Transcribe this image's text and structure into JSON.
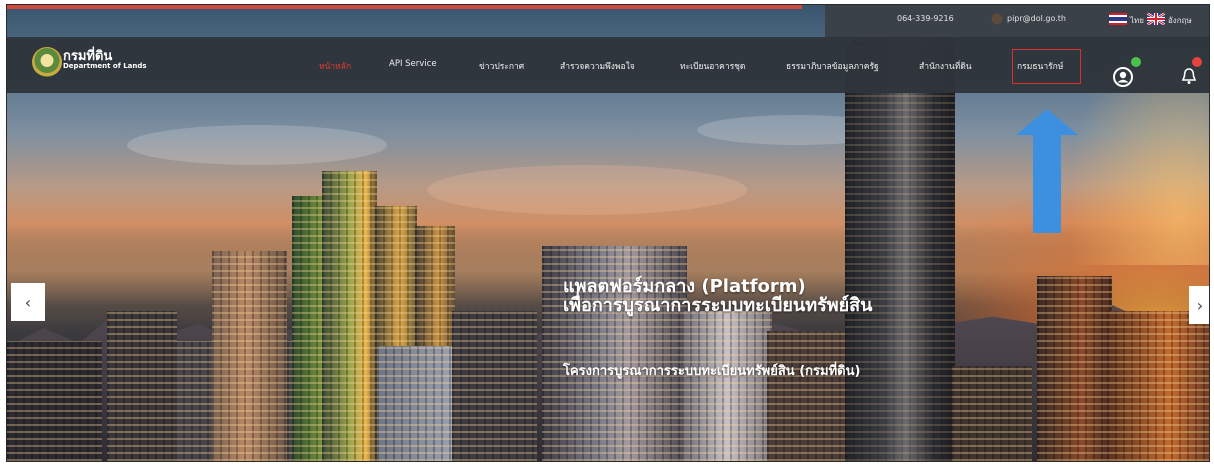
{
  "topbar": {
    "phone": "064-339-9216",
    "email": "pipr@dol.go.th",
    "lang_th": "ไทย",
    "lang_en": "อังกฤษ"
  },
  "brand": {
    "name_th": "กรมที่ดิน",
    "name_en": "Department of Lands"
  },
  "nav": {
    "items": [
      {
        "label": "หน้าหลัก"
      },
      {
        "label": "API Service"
      },
      {
        "label": "ข่าวประกาศ"
      },
      {
        "label": "สำรวจความพึงพอใจ"
      },
      {
        "label": "ทะเบียนอาคารชุด"
      },
      {
        "label": "ธรรมาภิบาลข้อมูลภาครัฐ"
      },
      {
        "label": "สำนักงานที่ดิน"
      },
      {
        "label": "กรมธนารักษ์"
      }
    ]
  },
  "hero": {
    "title_line1": "แพลตฟอร์มกลาง (Platform)",
    "title_line2": "เพื่อการบูรณาการระบบทะเบียนทรัพย์สิน",
    "subtitle": "โครงการบูรณาการระบบทะเบียนทรัพย์สิน (กรมที่ดิน)"
  },
  "carousel": {
    "prev": "‹",
    "next": "›"
  },
  "icons": {
    "seal": "department-seal-icon",
    "phone": "phone-icon",
    "email": "email-icon",
    "flag_th": "thai-flag-icon",
    "flag_uk": "uk-flag-icon",
    "user": "user-icon",
    "bell": "bell-icon",
    "arrow": "up-arrow-icon"
  },
  "colors": {
    "accent_red": "#d9302a",
    "nav_bg": "#2e343a",
    "arrow_blue": "#3d8fe0",
    "badge_green": "#4bc24d",
    "badge_red": "#e4443d"
  }
}
